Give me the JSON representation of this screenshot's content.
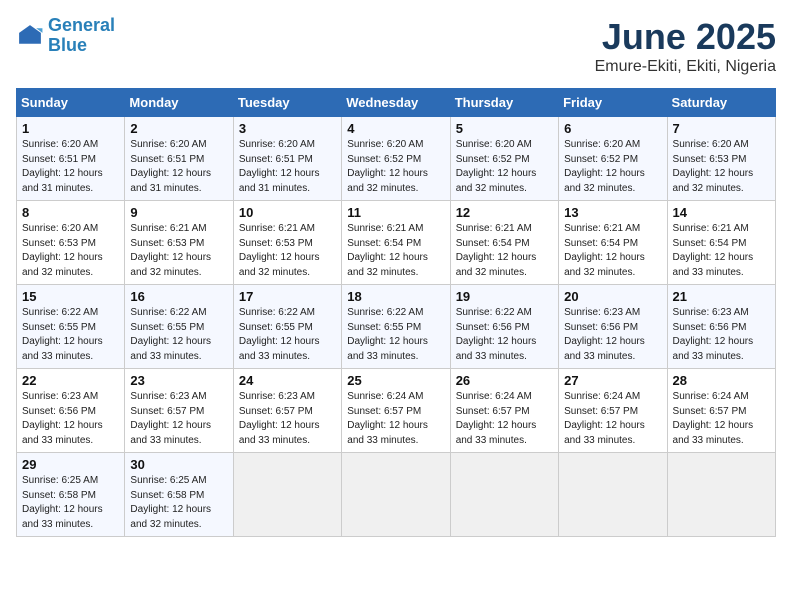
{
  "logo": {
    "line1": "General",
    "line2": "Blue"
  },
  "title": "June 2025",
  "subtitle": "Emure-Ekiti, Ekiti, Nigeria",
  "days_of_week": [
    "Sunday",
    "Monday",
    "Tuesday",
    "Wednesday",
    "Thursday",
    "Friday",
    "Saturday"
  ],
  "weeks": [
    [
      {
        "day": "1",
        "info": "Sunrise: 6:20 AM\nSunset: 6:51 PM\nDaylight: 12 hours\nand 31 minutes."
      },
      {
        "day": "2",
        "info": "Sunrise: 6:20 AM\nSunset: 6:51 PM\nDaylight: 12 hours\nand 31 minutes."
      },
      {
        "day": "3",
        "info": "Sunrise: 6:20 AM\nSunset: 6:51 PM\nDaylight: 12 hours\nand 31 minutes."
      },
      {
        "day": "4",
        "info": "Sunrise: 6:20 AM\nSunset: 6:52 PM\nDaylight: 12 hours\nand 32 minutes."
      },
      {
        "day": "5",
        "info": "Sunrise: 6:20 AM\nSunset: 6:52 PM\nDaylight: 12 hours\nand 32 minutes."
      },
      {
        "day": "6",
        "info": "Sunrise: 6:20 AM\nSunset: 6:52 PM\nDaylight: 12 hours\nand 32 minutes."
      },
      {
        "day": "7",
        "info": "Sunrise: 6:20 AM\nSunset: 6:53 PM\nDaylight: 12 hours\nand 32 minutes."
      }
    ],
    [
      {
        "day": "8",
        "info": "Sunrise: 6:20 AM\nSunset: 6:53 PM\nDaylight: 12 hours\nand 32 minutes."
      },
      {
        "day": "9",
        "info": "Sunrise: 6:21 AM\nSunset: 6:53 PM\nDaylight: 12 hours\nand 32 minutes."
      },
      {
        "day": "10",
        "info": "Sunrise: 6:21 AM\nSunset: 6:53 PM\nDaylight: 12 hours\nand 32 minutes."
      },
      {
        "day": "11",
        "info": "Sunrise: 6:21 AM\nSunset: 6:54 PM\nDaylight: 12 hours\nand 32 minutes."
      },
      {
        "day": "12",
        "info": "Sunrise: 6:21 AM\nSunset: 6:54 PM\nDaylight: 12 hours\nand 32 minutes."
      },
      {
        "day": "13",
        "info": "Sunrise: 6:21 AM\nSunset: 6:54 PM\nDaylight: 12 hours\nand 32 minutes."
      },
      {
        "day": "14",
        "info": "Sunrise: 6:21 AM\nSunset: 6:54 PM\nDaylight: 12 hours\nand 33 minutes."
      }
    ],
    [
      {
        "day": "15",
        "info": "Sunrise: 6:22 AM\nSunset: 6:55 PM\nDaylight: 12 hours\nand 33 minutes."
      },
      {
        "day": "16",
        "info": "Sunrise: 6:22 AM\nSunset: 6:55 PM\nDaylight: 12 hours\nand 33 minutes."
      },
      {
        "day": "17",
        "info": "Sunrise: 6:22 AM\nSunset: 6:55 PM\nDaylight: 12 hours\nand 33 minutes."
      },
      {
        "day": "18",
        "info": "Sunrise: 6:22 AM\nSunset: 6:55 PM\nDaylight: 12 hours\nand 33 minutes."
      },
      {
        "day": "19",
        "info": "Sunrise: 6:22 AM\nSunset: 6:56 PM\nDaylight: 12 hours\nand 33 minutes."
      },
      {
        "day": "20",
        "info": "Sunrise: 6:23 AM\nSunset: 6:56 PM\nDaylight: 12 hours\nand 33 minutes."
      },
      {
        "day": "21",
        "info": "Sunrise: 6:23 AM\nSunset: 6:56 PM\nDaylight: 12 hours\nand 33 minutes."
      }
    ],
    [
      {
        "day": "22",
        "info": "Sunrise: 6:23 AM\nSunset: 6:56 PM\nDaylight: 12 hours\nand 33 minutes."
      },
      {
        "day": "23",
        "info": "Sunrise: 6:23 AM\nSunset: 6:57 PM\nDaylight: 12 hours\nand 33 minutes."
      },
      {
        "day": "24",
        "info": "Sunrise: 6:23 AM\nSunset: 6:57 PM\nDaylight: 12 hours\nand 33 minutes."
      },
      {
        "day": "25",
        "info": "Sunrise: 6:24 AM\nSunset: 6:57 PM\nDaylight: 12 hours\nand 33 minutes."
      },
      {
        "day": "26",
        "info": "Sunrise: 6:24 AM\nSunset: 6:57 PM\nDaylight: 12 hours\nand 33 minutes."
      },
      {
        "day": "27",
        "info": "Sunrise: 6:24 AM\nSunset: 6:57 PM\nDaylight: 12 hours\nand 33 minutes."
      },
      {
        "day": "28",
        "info": "Sunrise: 6:24 AM\nSunset: 6:57 PM\nDaylight: 12 hours\nand 33 minutes."
      }
    ],
    [
      {
        "day": "29",
        "info": "Sunrise: 6:25 AM\nSunset: 6:58 PM\nDaylight: 12 hours\nand 33 minutes."
      },
      {
        "day": "30",
        "info": "Sunrise: 6:25 AM\nSunset: 6:58 PM\nDaylight: 12 hours\nand 32 minutes."
      },
      null,
      null,
      null,
      null,
      null
    ]
  ]
}
